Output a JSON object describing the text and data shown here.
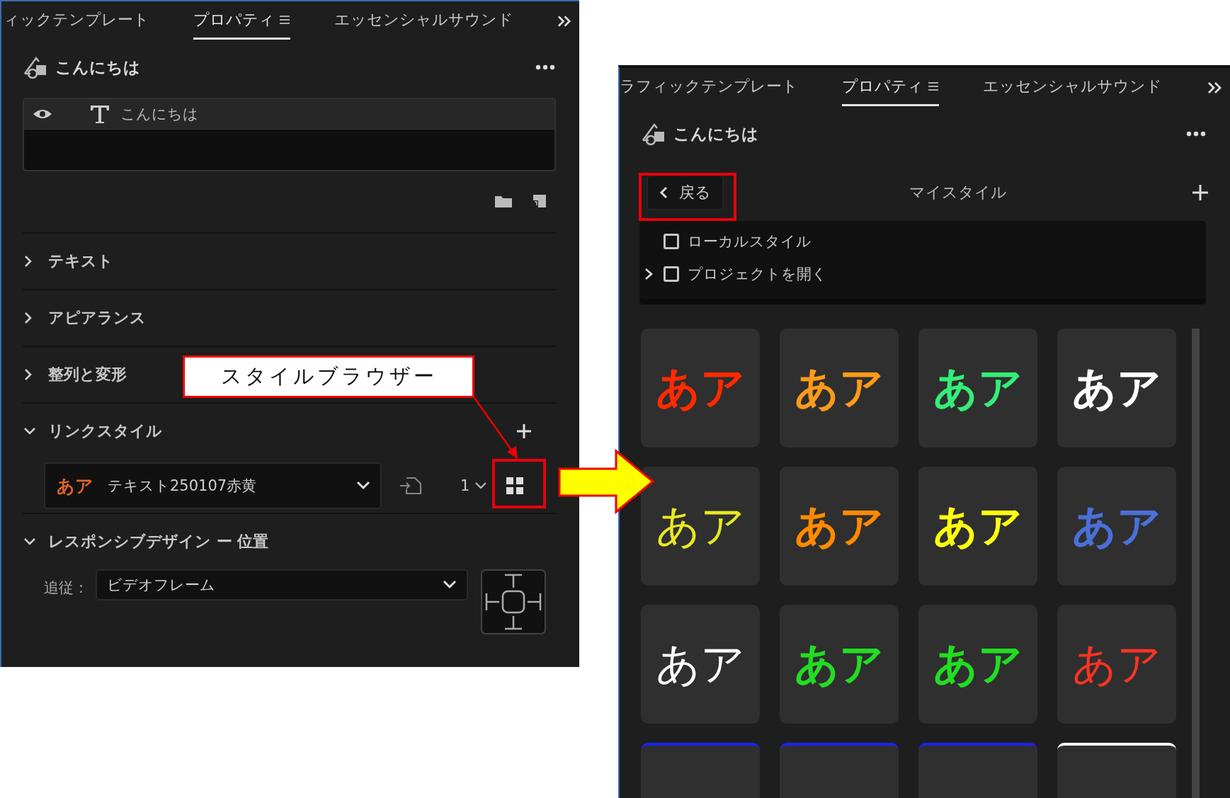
{
  "panels": [
    {
      "tabs": [
        {
          "label": "ィックテンプレート",
          "selected": false
        },
        {
          "label": "プロパティ",
          "selected": true
        },
        {
          "label": "エッセンシャルサウンド",
          "selected": false
        }
      ],
      "title": "こんにちは",
      "layers": [
        {
          "name": "こんにちは",
          "visible": true
        }
      ],
      "sections": [
        {
          "kind": "plain",
          "label": "テキスト",
          "expanded": false
        },
        {
          "kind": "plain",
          "label": "アピアランス",
          "expanded": false
        },
        {
          "kind": "plain",
          "label": "整列と変形",
          "expanded": false
        },
        {
          "kind": "link_style",
          "label": "リンクスタイル",
          "expanded": true,
          "preview": "あア",
          "value": "テキスト250107赤黄",
          "count": "1"
        },
        {
          "kind": "responsive",
          "label": "レスポンシブデザイン ー 位置",
          "expanded": true,
          "field_label": "追従：",
          "value": "ビデオフレーム"
        }
      ]
    },
    {
      "tabs": [
        {
          "label": "ラフィックテンプレート",
          "selected": false
        },
        {
          "label": "プロパティ",
          "selected": true
        },
        {
          "label": "エッセンシャルサウンド",
          "selected": false
        }
      ],
      "title": "こんにちは",
      "back_button": "戻る",
      "heading": "マイスタイル",
      "folders": [
        {
          "label": "ローカルスタイル",
          "checked": false,
          "expandable": false
        },
        {
          "label": "プロジェクトを開く",
          "checked": false,
          "expandable": true
        }
      ],
      "styles": [
        {
          "text": "あア",
          "kind": "bold",
          "color": "#ff2a00"
        },
        {
          "text": "あア",
          "kind": "bold",
          "color": "#ff9a1a"
        },
        {
          "text": "あア",
          "kind": "bold",
          "color": "#33ee77"
        },
        {
          "text": "あア",
          "kind": "bold",
          "color": "#ffffff"
        },
        {
          "text": "あア",
          "kind": "thin",
          "color": "#e8e820"
        },
        {
          "text": "あア",
          "kind": "bold",
          "color": "#ff8a00"
        },
        {
          "text": "あア",
          "kind": "bold",
          "color": "#ffff10"
        },
        {
          "text": "あア",
          "kind": "bold",
          "color": "#4a70d8"
        },
        {
          "text": "あア",
          "kind": "thin",
          "color": "#ffffff"
        },
        {
          "text": "あア",
          "kind": "bold",
          "color": "#22dd22"
        },
        {
          "text": "あア",
          "kind": "bold",
          "color": "#22dd22"
        },
        {
          "text": "あア",
          "kind": "thin",
          "color": "#ff3322"
        },
        {
          "kind": "cut",
          "color": "#1a22ee"
        },
        {
          "kind": "cut",
          "color": "#1a22ee"
        },
        {
          "kind": "cut",
          "color": "#1a22ee"
        },
        {
          "kind": "cut",
          "color": "#ffffff"
        }
      ]
    }
  ],
  "callout": "スタイルブラウザー"
}
